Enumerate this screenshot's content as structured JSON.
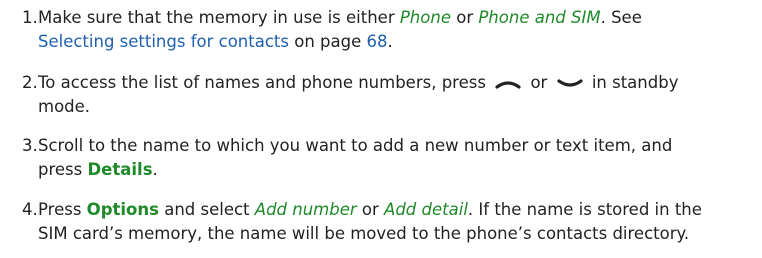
{
  "steps": [
    {
      "number": "1.",
      "a": "Make sure that the memory in use is either ",
      "phone": "Phone",
      "or": " or ",
      "phone_sim": "Phone and SIM",
      "see": ". See",
      "link": "Selecting settings for contacts",
      "on_page": " on page ",
      "page": "68",
      "end": "."
    },
    {
      "number": "2.",
      "a": "To access the list of names and phone numbers, press",
      "or": "or",
      "b": "in standby",
      "c": "mode.",
      "icons": [
        "left-softkey-icon",
        "right-softkey-icon"
      ]
    },
    {
      "number": "3.",
      "a": "Scroll to the name to which you want to add a new number or text item, and",
      "b": "press ",
      "details": "Details",
      "end": "."
    },
    {
      "number": "4.",
      "press": "Press ",
      "options": "Options",
      "select": " and select ",
      "add_number": "Add number",
      "or": " or ",
      "add_detail": "Add detail",
      "rest": ". If the name is stored in the",
      "line2": "SIM card’s memory, the name will be moved to the phone’s contacts directory."
    }
  ],
  "colors": {
    "text": "#222222",
    "keyword": "#1f8a2a",
    "link": "#1f5fb0"
  }
}
